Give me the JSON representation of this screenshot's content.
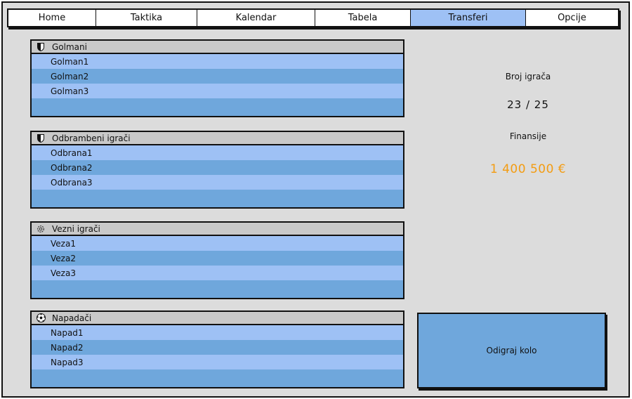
{
  "tabs": [
    {
      "label": "Home",
      "active": false
    },
    {
      "label": "Taktika",
      "active": false
    },
    {
      "label": "Kalendar",
      "active": false
    },
    {
      "label": "Tabela",
      "active": false
    },
    {
      "label": "Transferi",
      "active": true
    },
    {
      "label": "Opcije",
      "active": false
    }
  ],
  "groups": {
    "goalkeepers": {
      "title": "Golmani",
      "icon": "shield-icon",
      "players": [
        "Golman1",
        "Golman2",
        "Golman3"
      ]
    },
    "defenders": {
      "title": "Odbrambeni igrači",
      "icon": "shield-icon",
      "players": [
        "Odbrana1",
        "Odbrana2",
        "Odbrana3"
      ]
    },
    "midfielders": {
      "title": "Vezni igrači",
      "icon": "gear-icon",
      "players": [
        "Veza1",
        "Veza2",
        "Veza3"
      ]
    },
    "forwards": {
      "title": "Napadači",
      "icon": "soccer-ball-icon",
      "players": [
        "Napad1",
        "Napad2",
        "Napad3"
      ]
    }
  },
  "info": {
    "players_label": "Broj igrača",
    "players_value": "23 / 25",
    "finance_label": "Finansije",
    "finance_value": "1 400 500 €"
  },
  "actions": {
    "play_round": "Odigraj kolo"
  },
  "colors": {
    "window_bg": "#dcdcdc",
    "row_light": "#9ec1f5",
    "row_dark": "#6fa7dc",
    "header_bg": "#c9c9c9",
    "money": "#f39c12"
  }
}
